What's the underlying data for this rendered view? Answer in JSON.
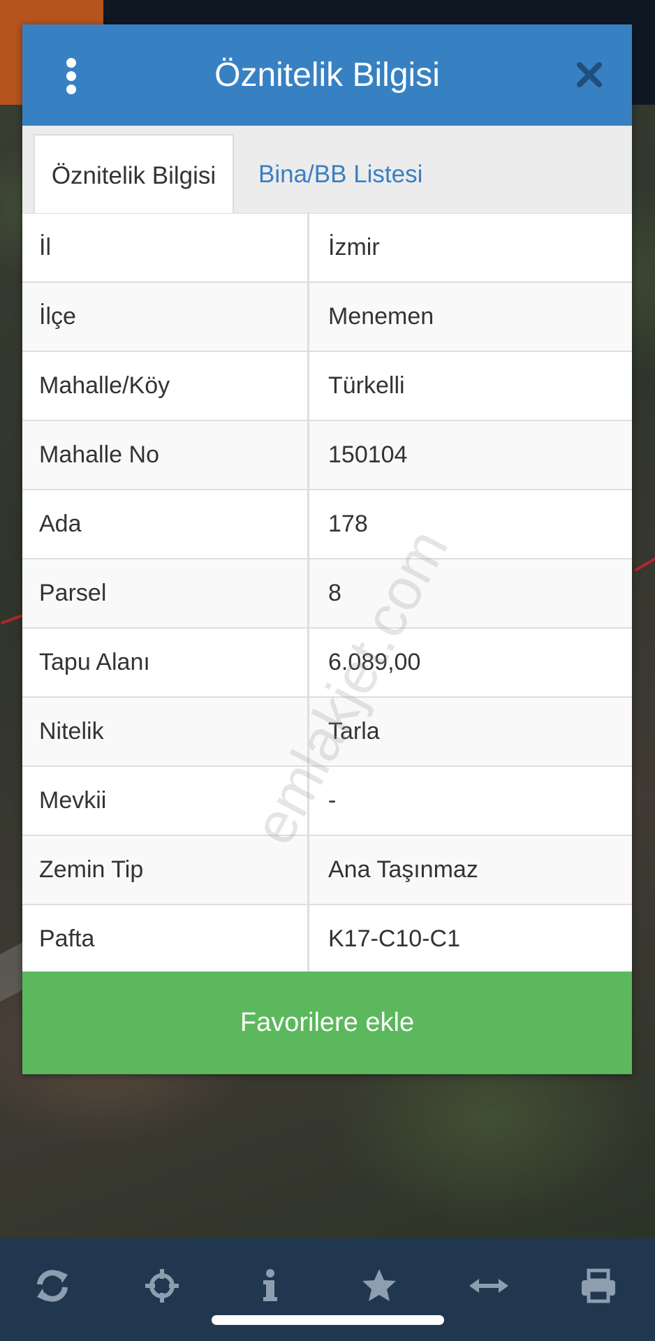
{
  "dialog": {
    "title": "Öznitelik Bilgisi",
    "tabs": [
      {
        "label": "Öznitelik Bilgisi",
        "active": true
      },
      {
        "label": "Bina/BB Listesi",
        "active": false
      }
    ],
    "rows": [
      {
        "key": "İl",
        "value": "İzmir"
      },
      {
        "key": "İlçe",
        "value": "Menemen"
      },
      {
        "key": "Mahalle/Köy",
        "value": "Türkelli"
      },
      {
        "key": "Mahalle No",
        "value": "150104"
      },
      {
        "key": "Ada",
        "value": "178"
      },
      {
        "key": "Parsel",
        "value": "8"
      },
      {
        "key": "Tapu Alanı",
        "value": "6.089,00"
      },
      {
        "key": "Nitelik",
        "value": "Tarla"
      },
      {
        "key": "Mevkii",
        "value": "-"
      },
      {
        "key": "Zemin Tip",
        "value": "Ana Taşınmaz"
      },
      {
        "key": "Pafta",
        "value": "K17-C10-C1"
      }
    ],
    "favorite_button": "Favorilere ekle"
  },
  "watermark": "emlakjet.com",
  "toolbar": {
    "icons": [
      "refresh-icon",
      "crosshair-icon",
      "info-icon",
      "star-icon",
      "measure-icon",
      "print-icon"
    ]
  },
  "colors": {
    "header": "#3781c3",
    "tab_link": "#3a7fc1",
    "favorite_button": "#5cb85c",
    "toolbar": "#20374f",
    "toolbar_icon": "#8d9eae"
  }
}
